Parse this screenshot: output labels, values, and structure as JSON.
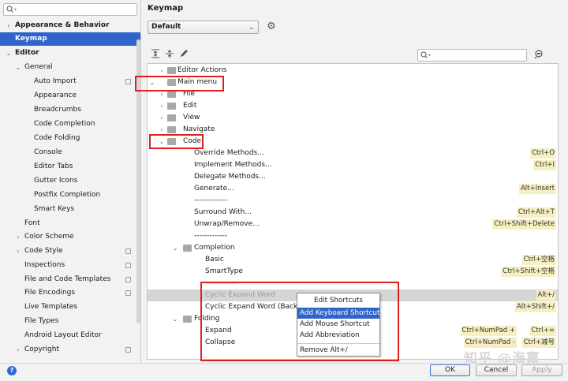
{
  "sidebar": {
    "search_placeholder": "",
    "items": [
      {
        "label": "Appearance & Behavior",
        "arrow": "›"
      },
      {
        "label": "Keymap",
        "arrow": ""
      },
      {
        "label": "Editor",
        "arrow": "⌄"
      },
      {
        "label": "General",
        "arrow": "⌄"
      },
      {
        "label": "Auto Import",
        "arrow": ""
      },
      {
        "label": "Appearance",
        "arrow": ""
      },
      {
        "label": "Breadcrumbs",
        "arrow": ""
      },
      {
        "label": "Code Completion",
        "arrow": ""
      },
      {
        "label": "Code Folding",
        "arrow": ""
      },
      {
        "label": "Console",
        "arrow": ""
      },
      {
        "label": "Editor Tabs",
        "arrow": ""
      },
      {
        "label": "Gutter Icons",
        "arrow": ""
      },
      {
        "label": "Postfix Completion",
        "arrow": ""
      },
      {
        "label": "Smart Keys",
        "arrow": ""
      },
      {
        "label": "Font",
        "arrow": ""
      },
      {
        "label": "Color Scheme",
        "arrow": "›"
      },
      {
        "label": "Code Style",
        "arrow": "›"
      },
      {
        "label": "Inspections",
        "arrow": ""
      },
      {
        "label": "File and Code Templates",
        "arrow": ""
      },
      {
        "label": "File Encodings",
        "arrow": ""
      },
      {
        "label": "Live Templates",
        "arrow": ""
      },
      {
        "label": "File Types",
        "arrow": ""
      },
      {
        "label": "Android Layout Editor",
        "arrow": ""
      },
      {
        "label": "Copyright",
        "arrow": "›"
      }
    ]
  },
  "main": {
    "title": "Keymap",
    "keymap_selected": "Default",
    "tree": [
      {
        "label": "Editor Actions",
        "arrow": "›",
        "shortcuts": []
      },
      {
        "label": "Main menu",
        "arrow": "⌄",
        "shortcuts": []
      },
      {
        "label": "File",
        "arrow": "›",
        "shortcuts": []
      },
      {
        "label": "Edit",
        "arrow": "›",
        "shortcuts": []
      },
      {
        "label": "View",
        "arrow": "›",
        "shortcuts": []
      },
      {
        "label": "Navigate",
        "arrow": "›",
        "shortcuts": []
      },
      {
        "label": "Code",
        "arrow": "⌄",
        "shortcuts": []
      },
      {
        "label": "Override Methods...",
        "arrow": "",
        "shortcuts": [
          "Ctrl+O"
        ]
      },
      {
        "label": "Implement Methods...",
        "arrow": "",
        "shortcuts": [
          "Ctrl+I"
        ]
      },
      {
        "label": "Delegate Methods...",
        "arrow": "",
        "shortcuts": []
      },
      {
        "label": "Generate...",
        "arrow": "",
        "shortcuts": [
          "Alt+Insert"
        ]
      },
      {
        "label": "-------------",
        "arrow": "",
        "shortcuts": []
      },
      {
        "label": "Surround With...",
        "arrow": "",
        "shortcuts": [
          "Ctrl+Alt+T"
        ]
      },
      {
        "label": "Unwrap/Remove...",
        "arrow": "",
        "shortcuts": [
          "Ctrl+Shift+Delete"
        ]
      },
      {
        "label": "-------------",
        "arrow": "",
        "shortcuts": []
      },
      {
        "label": "Completion",
        "arrow": "⌄",
        "shortcuts": []
      },
      {
        "label": "Basic",
        "arrow": "",
        "shortcuts": [
          "Ctrl+空格"
        ]
      },
      {
        "label": "SmartType",
        "arrow": "",
        "shortcuts": [
          "Ctrl+Shift+空格"
        ]
      },
      {
        "label": "-------------",
        "arrow": "",
        "shortcuts": []
      },
      {
        "label": "Cyclic Expand Word",
        "arrow": "",
        "shortcuts": [
          "Alt+/"
        ]
      },
      {
        "label": "Cyclic Expand Word (Backward)",
        "arrow": "",
        "shortcuts": [
          "Alt+Shift+/"
        ]
      },
      {
        "label": "Folding",
        "arrow": "⌄",
        "shortcuts": []
      },
      {
        "label": "Expand",
        "arrow": "",
        "shortcuts": [
          "Ctrl+NumPad +",
          "Ctrl+="
        ]
      },
      {
        "label": "Collapse",
        "arrow": "",
        "shortcuts": [
          "Ctrl+NumPad -",
          "Ctrl+减号"
        ]
      }
    ]
  },
  "context_menu": {
    "items": [
      "Edit Shortcuts",
      "Add Keyboard Shortcut",
      "Add Mouse Shortcut",
      "Add Abbreviation",
      "Remove Alt+/"
    ]
  },
  "footer": {
    "help": "?",
    "ok": "OK",
    "cancel": "Cancel",
    "apply": "Apply"
  },
  "watermark": "知乎 @海嘉",
  "colors": {
    "selection": "#2f65ca",
    "shortcut_bg": "#f5efc2",
    "annotation": "#e02020"
  }
}
